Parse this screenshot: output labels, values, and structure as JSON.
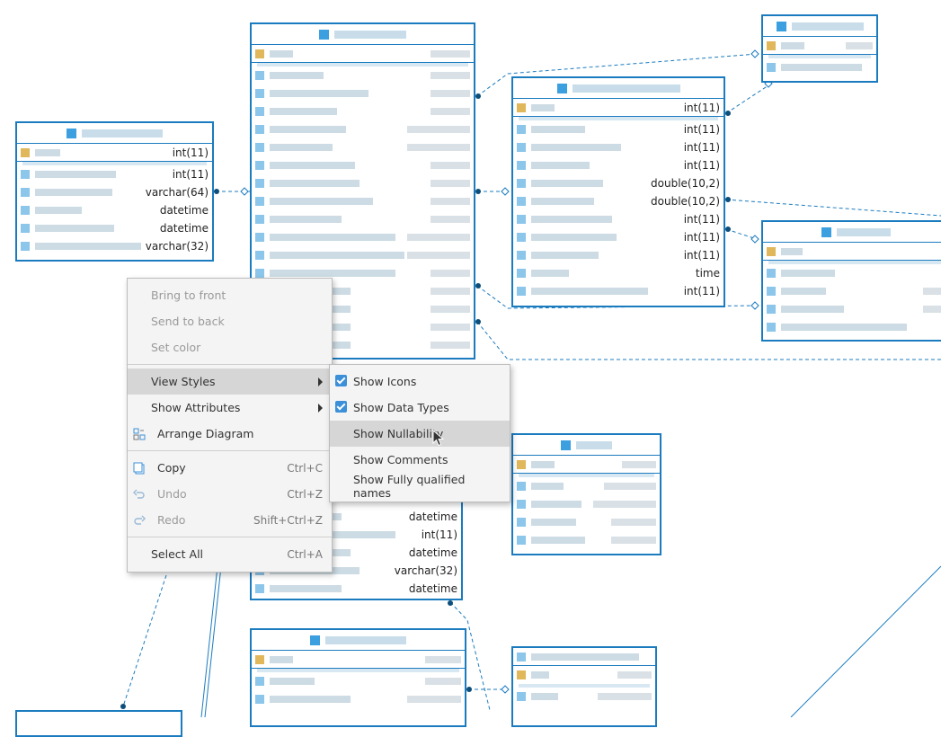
{
  "diagram": {
    "colors": {
      "border": "#1b7bbf",
      "accent": "#3c8fd9",
      "menu_bg": "#f4f4f4",
      "highlight": "#d6d6d6"
    },
    "entities": {
      "left": {
        "types": [
          "int(11)",
          "int(11)",
          "varchar(64)",
          "datetime",
          "datetime",
          "varchar(32)"
        ]
      },
      "right": {
        "types": [
          "int(11)",
          "int(11)",
          "int(11)",
          "int(11)",
          "double(10,2)",
          "double(10,2)",
          "int(11)",
          "int(11)",
          "int(11)",
          "time",
          "int(11)"
        ]
      },
      "center_lower": {
        "types": [
          "datetime",
          "int(11)",
          "datetime",
          "varchar(32)",
          "datetime"
        ]
      }
    }
  },
  "context_menu": {
    "items": [
      {
        "label": "Bring to front",
        "disabled": true
      },
      {
        "label": "Send to back",
        "disabled": true
      },
      {
        "label": "Set color",
        "disabled": true
      },
      {
        "label": "View Styles",
        "submenu": true,
        "highlighted": true
      },
      {
        "label": "Show Attributes",
        "submenu": true
      },
      {
        "label": "Arrange Diagram",
        "icon": "arrange-icon"
      },
      {
        "label": "Copy",
        "shortcut": "Ctrl+C",
        "icon": "copy-icon"
      },
      {
        "label": "Undo",
        "shortcut": "Ctrl+Z",
        "icon": "undo-icon",
        "disabled": true
      },
      {
        "label": "Redo",
        "shortcut": "Shift+Ctrl+Z",
        "icon": "redo-icon",
        "disabled": true
      },
      {
        "label": "Select All",
        "shortcut": "Ctrl+A"
      }
    ]
  },
  "submenu": {
    "items": [
      {
        "label": "Show Icons",
        "checked": true
      },
      {
        "label": "Show Data Types",
        "checked": true
      },
      {
        "label": "Show Nullability",
        "checked": false,
        "hover": true
      },
      {
        "label": "Show Comments",
        "checked": false
      },
      {
        "label": "Show Fully qualified names",
        "checked": false
      }
    ]
  }
}
